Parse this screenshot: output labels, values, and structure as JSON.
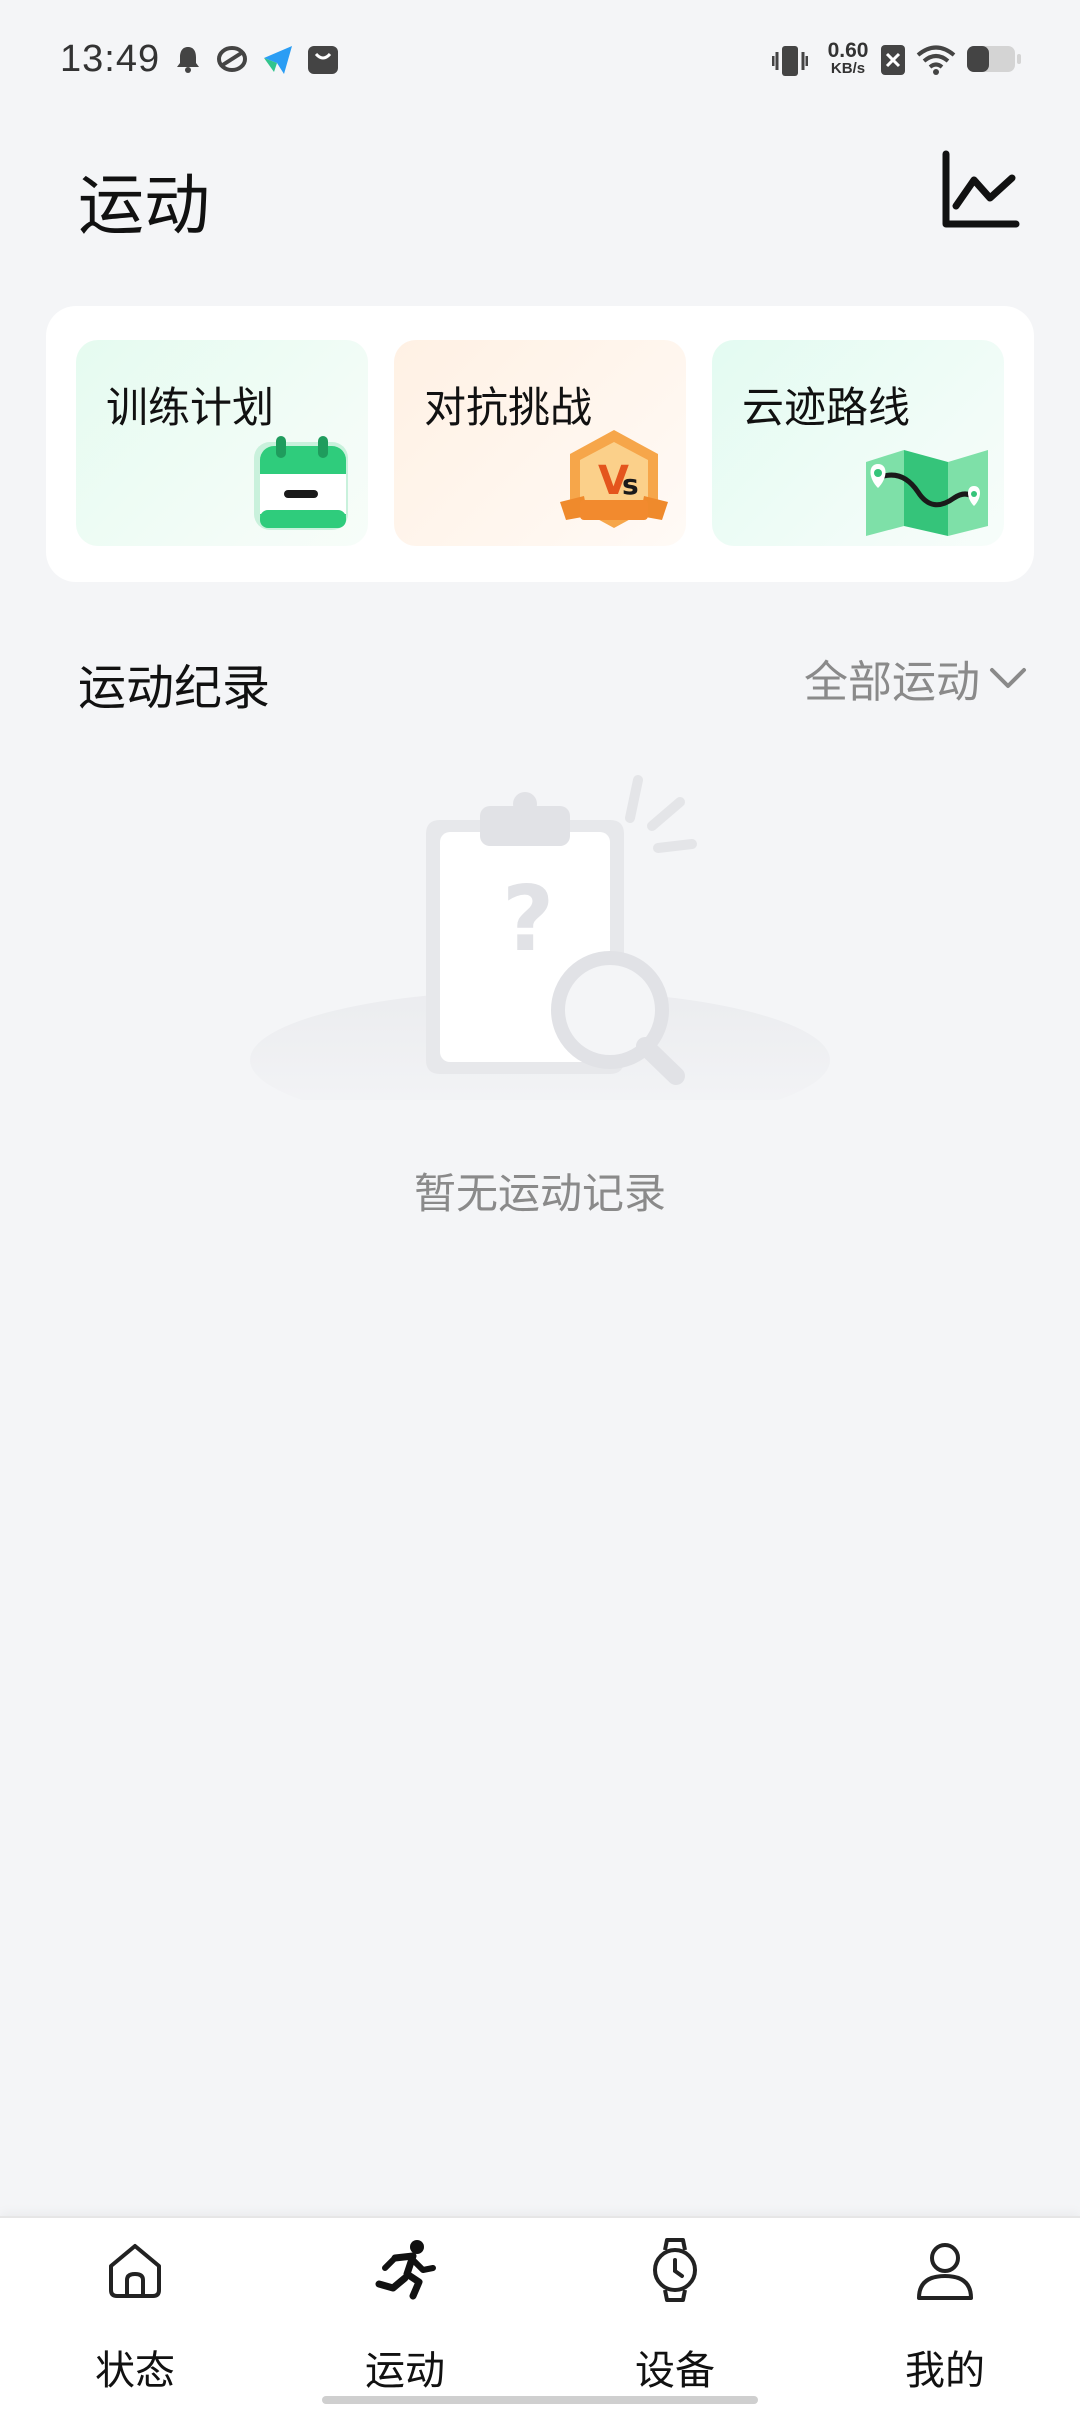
{
  "status_bar": {
    "time": "13:49",
    "net_speed_value": "0.60",
    "net_speed_unit": "KB/s",
    "icons": [
      "bell-icon",
      "app-icon",
      "send-icon",
      "bag-icon",
      "vibrate-icon",
      "sim-off-icon",
      "wifi-icon",
      "battery-icon"
    ],
    "battery_level": 0.45
  },
  "header": {
    "title": "运动",
    "chart_icon": "line-chart-icon"
  },
  "quick_cards": [
    {
      "label": "训练计划",
      "icon": "calendar-icon",
      "accent": "#2fcc7c"
    },
    {
      "label": "对抗挑战",
      "icon": "vs-badge-icon",
      "accent": "#f28a2e"
    },
    {
      "label": "云迹路线",
      "icon": "route-map-icon",
      "accent": "#35c47a"
    }
  ],
  "records": {
    "title": "运动纪录",
    "filter_label": "全部运动",
    "empty_text": "暂无运动记录"
  },
  "bottom_nav": {
    "items": [
      {
        "label": "状态",
        "icon": "home-icon",
        "active": false
      },
      {
        "label": "运动",
        "icon": "running-icon",
        "active": true
      },
      {
        "label": "设备",
        "icon": "watch-icon",
        "active": false
      },
      {
        "label": "我的",
        "icon": "person-icon",
        "active": false
      }
    ]
  }
}
